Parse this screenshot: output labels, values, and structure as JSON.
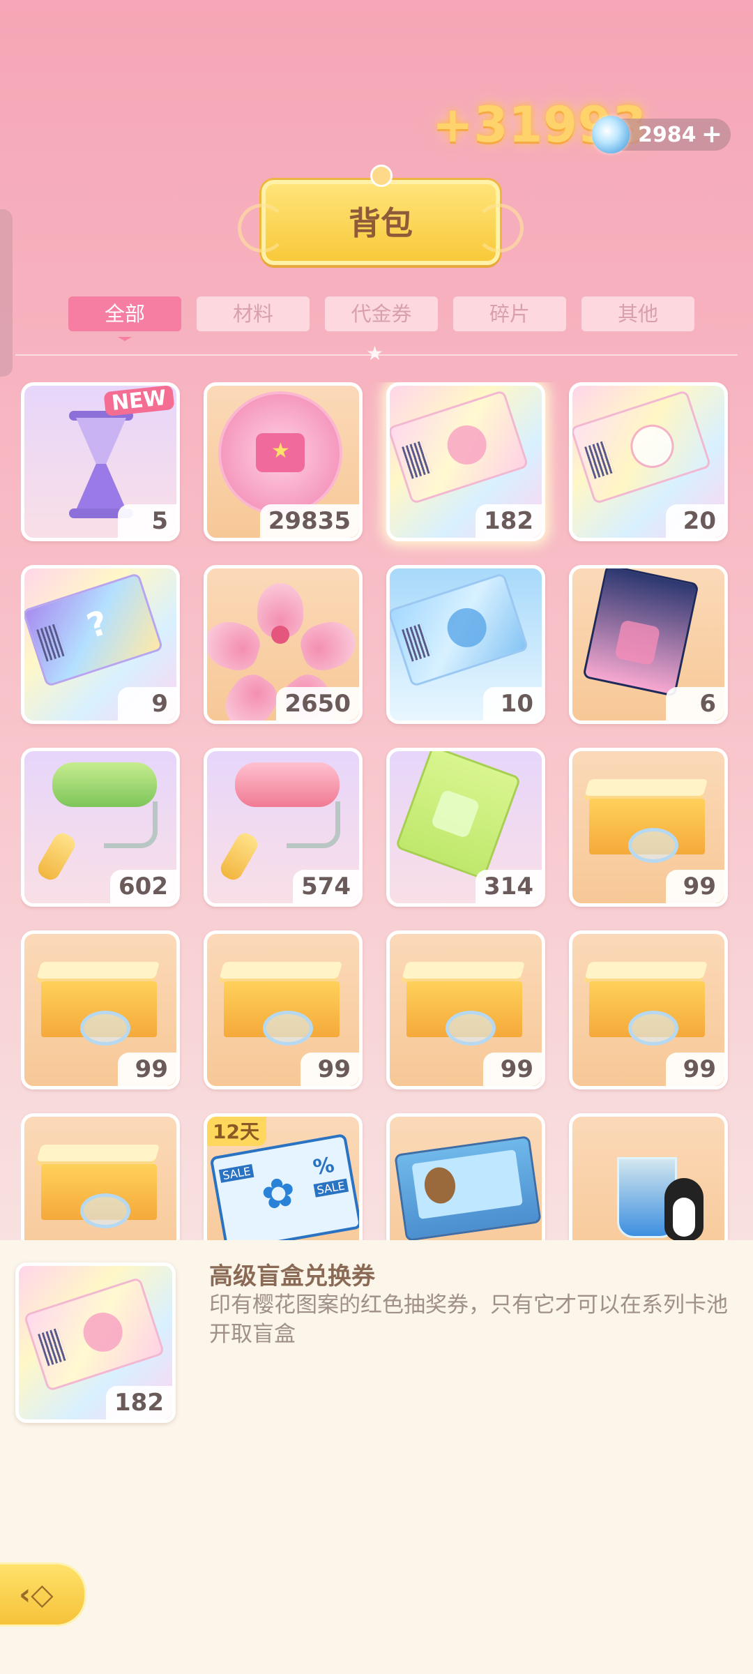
{
  "header": {
    "gain_text": "+31993",
    "currency_amount": "2984",
    "currency_plus": "+",
    "title": "背包"
  },
  "tabs": [
    {
      "label": "全部",
      "active": true
    },
    {
      "label": "材料",
      "active": false
    },
    {
      "label": "代金券",
      "active": false
    },
    {
      "label": "碎片",
      "active": false
    },
    {
      "label": "其他",
      "active": false
    }
  ],
  "items": [
    {
      "icon": "hourglass-icon",
      "count": "5",
      "badge": "NEW"
    },
    {
      "icon": "pink-coin-icon",
      "count": "29835"
    },
    {
      "icon": "premium-blindbox-ticket-icon",
      "count": "182",
      "selected": true
    },
    {
      "icon": "rainbow-ticket-icon",
      "count": "20"
    },
    {
      "icon": "mystery-ticket-icon",
      "count": "9"
    },
    {
      "icon": "sakura-flower-icon",
      "count": "2650"
    },
    {
      "icon": "blue-ticket-icon",
      "count": "10"
    },
    {
      "icon": "navy-ticket-icon",
      "count": "6"
    },
    {
      "icon": "green-roller-icon",
      "count": "602"
    },
    {
      "icon": "pink-roller-icon",
      "count": "574"
    },
    {
      "icon": "green-ticket-icon",
      "count": "314"
    },
    {
      "icon": "gift-box-icon",
      "count": "99"
    },
    {
      "icon": "gift-box-icon",
      "count": "99"
    },
    {
      "icon": "gift-box-icon",
      "count": "99"
    },
    {
      "icon": "gift-box-icon",
      "count": "99"
    },
    {
      "icon": "gift-box-icon",
      "count": "99"
    },
    {
      "icon": "gift-box-icon",
      "count": ""
    },
    {
      "icon": "discount-voucher-icon",
      "count": "",
      "badge": "12天",
      "badge_lines": [
        "SALE",
        "%",
        "SALE"
      ]
    },
    {
      "icon": "puzzle-box-icon",
      "count": ""
    },
    {
      "icon": "blue-drink-penguin-icon",
      "count": ""
    }
  ],
  "detail": {
    "name": "高级盲盒兑换券",
    "description": "印有樱花图案的红色抽奖券，只有它才可以在系列卡池开取盲盒",
    "count": "182"
  },
  "colors": {
    "active_tab": "#f57ea2",
    "title_plate": "#f8c93a",
    "detail_panel": "#fbf5ea"
  }
}
